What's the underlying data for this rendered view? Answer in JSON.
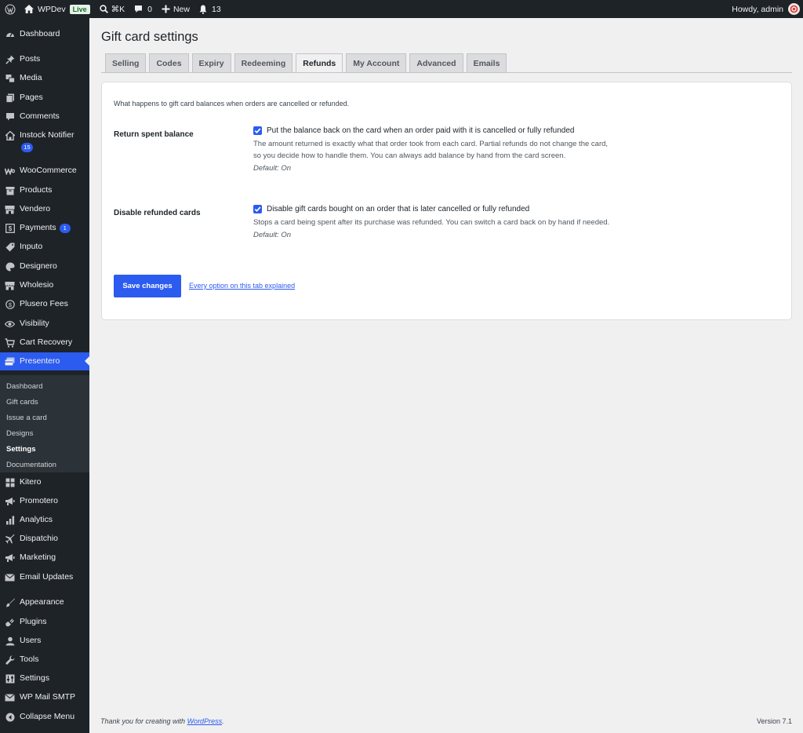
{
  "adminbar": {
    "site_name": "WPDev",
    "live_badge": "Live",
    "shortcut": "⌘K",
    "comments_count": "0",
    "new_label": "New",
    "notifications_count": "13",
    "greeting": "Howdy, admin"
  },
  "sidebar": {
    "items": [
      {
        "label": "Dashboard",
        "icon": "dashboard-icon"
      },
      {
        "label": "Posts",
        "icon": "pin-icon"
      },
      {
        "label": "Media",
        "icon": "media-icon"
      },
      {
        "label": "Pages",
        "icon": "pages-icon"
      },
      {
        "label": "Comments",
        "icon": "comment-icon"
      },
      {
        "label": "Instock Notifier",
        "icon": "house-icon",
        "badge": "15"
      },
      {
        "label": "WooCommerce",
        "icon": "woo-icon"
      },
      {
        "label": "Products",
        "icon": "box-icon"
      },
      {
        "label": "Vendero",
        "icon": "store-icon"
      },
      {
        "label": "Payments",
        "icon": "dollar-box-icon",
        "badge": "1"
      },
      {
        "label": "Inputo",
        "icon": "tag-icon"
      },
      {
        "label": "Designero",
        "icon": "palette-icon"
      },
      {
        "label": "Wholesio",
        "icon": "store-icon"
      },
      {
        "label": "Plusero Fees",
        "icon": "dollar-circle-icon"
      },
      {
        "label": "Visibility",
        "icon": "eye-icon"
      },
      {
        "label": "Cart Recovery",
        "icon": "cart-icon"
      },
      {
        "label": "Presentero",
        "icon": "gift-cards-icon"
      },
      {
        "label": "Kitero",
        "icon": "grid-icon"
      },
      {
        "label": "Promotero",
        "icon": "megaphone-icon"
      },
      {
        "label": "Analytics",
        "icon": "bars-icon"
      },
      {
        "label": "Dispatchio",
        "icon": "plane-icon"
      },
      {
        "label": "Marketing",
        "icon": "megaphone-icon"
      },
      {
        "label": "Email Updates",
        "icon": "mail-icon"
      },
      {
        "label": "Appearance",
        "icon": "brush-icon"
      },
      {
        "label": "Plugins",
        "icon": "plug-icon"
      },
      {
        "label": "Users",
        "icon": "user-icon"
      },
      {
        "label": "Tools",
        "icon": "wrench-icon"
      },
      {
        "label": "Settings",
        "icon": "sliders-icon"
      },
      {
        "label": "WP Mail SMTP",
        "icon": "mail-icon"
      },
      {
        "label": "Collapse Menu",
        "icon": "collapse-icon"
      }
    ],
    "submenu": [
      "Dashboard",
      "Gift cards",
      "Issue a card",
      "Designs",
      "Settings",
      "Documentation"
    ]
  },
  "page": {
    "title": "Gift card settings",
    "tabs": [
      "Selling",
      "Codes",
      "Expiry",
      "Redeeming",
      "Refunds",
      "My Account",
      "Advanced",
      "Emails"
    ],
    "active_tab": "Refunds",
    "intro": "What happens to gift card balances when orders are cancelled or refunded.",
    "fields": [
      {
        "label": "Return spent balance",
        "checkbox_label": "Put the balance back on the card when an order paid with it is cancelled or fully refunded",
        "checked": true,
        "description": "The amount returned is exactly what that order took from each card. Partial refunds do not change the card, so you decide how to handle them. You can always add balance by hand from the card screen.",
        "default": "Default: On"
      },
      {
        "label": "Disable refunded cards",
        "checkbox_label": "Disable gift cards bought on an order that is later cancelled or fully refunded",
        "checked": true,
        "description": "Stops a card being spent after its purchase was refunded. You can switch a card back on by hand if needed.",
        "default": "Default: On"
      }
    ],
    "save_label": "Save changes",
    "explain_link": "Every option on this tab explained"
  },
  "footer": {
    "thanks_prefix": "Thank you for creating with ",
    "thanks_link": "WordPress",
    "thanks_suffix": ".",
    "version": "Version 7.1"
  },
  "colors": {
    "accent": "#2c5bef",
    "sidebar_bg": "#1d2327",
    "page_bg": "#f0f0f1"
  }
}
